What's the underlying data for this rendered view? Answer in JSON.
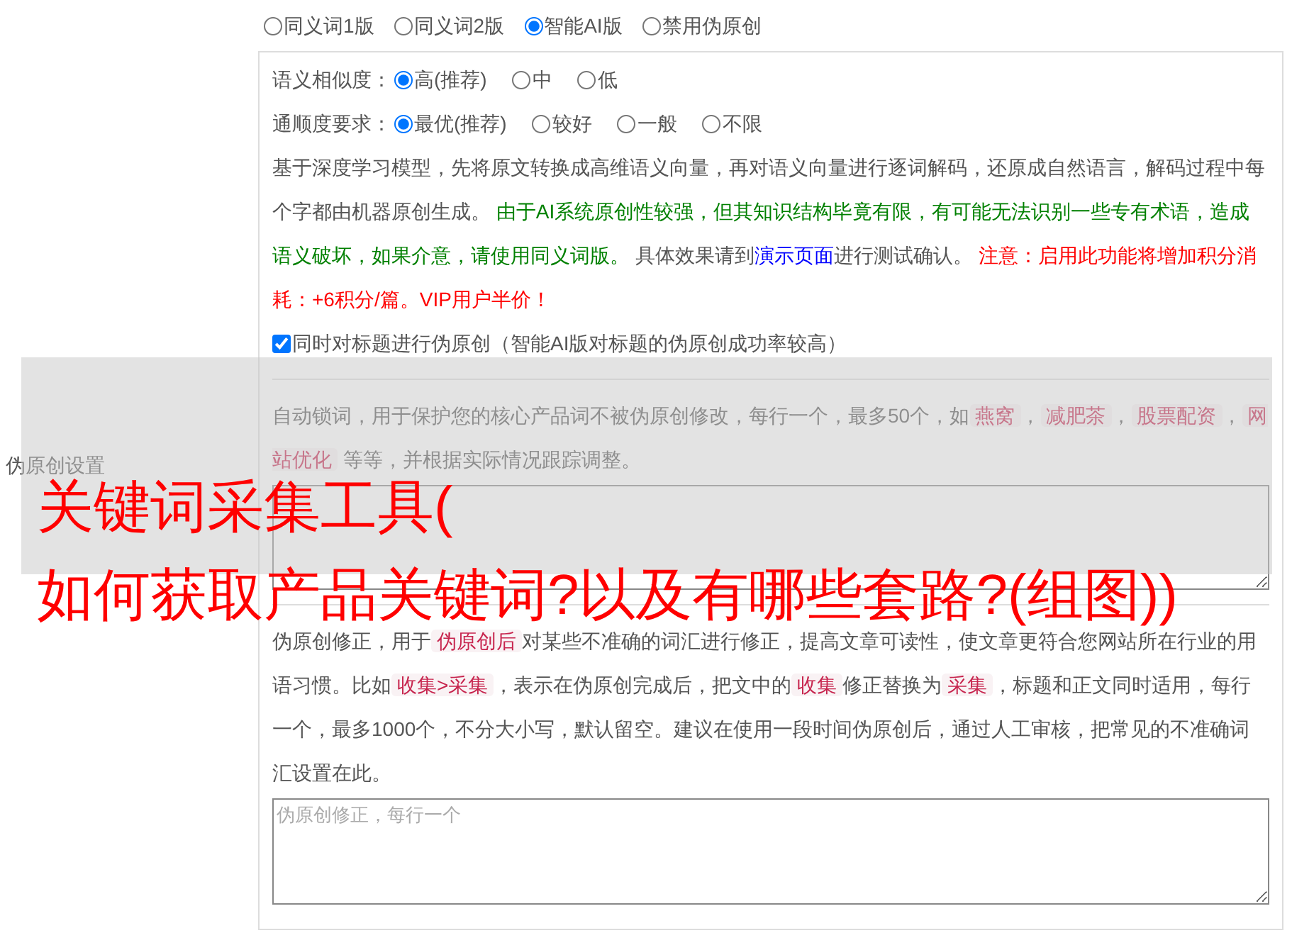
{
  "section_label": "伪原创设置",
  "modes": [
    {
      "label": "同义词1版",
      "selected": false
    },
    {
      "label": "同义词2版",
      "selected": false
    },
    {
      "label": "智能AI版",
      "selected": true
    },
    {
      "label": "禁用伪原创",
      "selected": false
    }
  ],
  "similarity": {
    "label": "语义相似度：",
    "options": [
      {
        "label": "高(推荐)",
        "selected": true
      },
      {
        "label": "中",
        "selected": false
      },
      {
        "label": "低",
        "selected": false
      }
    ]
  },
  "fluency": {
    "label": "通顺度要求：",
    "options": [
      {
        "label": "最优(推荐)",
        "selected": true
      },
      {
        "label": "较好",
        "selected": false
      },
      {
        "label": "一般",
        "selected": false
      },
      {
        "label": "不限",
        "selected": false
      }
    ]
  },
  "description": [
    {
      "kind": "plain",
      "text": "基于深度学习模型，先将原文转换成高维语义向量，再对语义向量进行逐词解码，还原成自然语言，解码过程中每个字都由机器原创生成。 "
    },
    {
      "kind": "caution",
      "text": "由于AI系统原创性较强，但其知识结构毕竟有限，有可能无法识别一些专有术语，造成语义破坏，如果介意，请使用同义词版。"
    },
    {
      "kind": "plain",
      "text": " 具体效果请到"
    },
    {
      "kind": "link",
      "text": "演示页面"
    },
    {
      "kind": "plain",
      "text": "进行测试确认。 "
    },
    {
      "kind": "warning",
      "text": "注意：启用此功能将增加积分消耗：+6积分/篇。VIP用户半价！"
    }
  ],
  "title_option": {
    "label": "同时对标题进行伪原创（智能AI版对标题的伪原创成功率较高）",
    "checked": true
  },
  "lock_words": {
    "description": [
      {
        "kind": "plain",
        "text": "自动锁词，用于保护您的核心产品词不被伪原创修改，每行一个，最多50个，如"
      },
      {
        "kind": "code",
        "text": "燕窝"
      },
      {
        "kind": "plain",
        "text": "，"
      },
      {
        "kind": "code",
        "text": "减肥茶"
      },
      {
        "kind": "plain",
        "text": "，"
      },
      {
        "kind": "code",
        "text": "股票配资"
      },
      {
        "kind": "plain",
        "text": "，"
      },
      {
        "kind": "code",
        "text": "网站优化"
      },
      {
        "kind": "plain",
        "text": " 等等，并根据实际情况跟踪调整。"
      }
    ]
  },
  "corrections": {
    "description": [
      {
        "kind": "plain",
        "text": "伪原创修正，用于"
      },
      {
        "kind": "code",
        "text": "伪原创后"
      },
      {
        "kind": "plain",
        "text": "对某些不准确的词汇进行修正，提高文章可读性，使文章更符合您网站所在行业的用语习惯。比如"
      },
      {
        "kind": "code",
        "text": "收集>采集"
      },
      {
        "kind": "plain",
        "text": "，表示在伪原创完成后，把文中的"
      },
      {
        "kind": "code",
        "text": "收集"
      },
      {
        "kind": "plain",
        "text": "修正替换为"
      },
      {
        "kind": "code",
        "text": "采集"
      },
      {
        "kind": "plain",
        "text": "，标题和正文同时适用，每行一个，最多1000个，不分大小写，默认留空。建议在使用一段时间伪原创后，通过人工审核，把常见的不准确词汇设置在此。"
      }
    ],
    "placeholder": "伪原创修正，每行一个"
  },
  "overlay_title": [
    "关键词采集工具(",
    "如何获取产品关键词?以及有哪些套路?(组图))"
  ]
}
